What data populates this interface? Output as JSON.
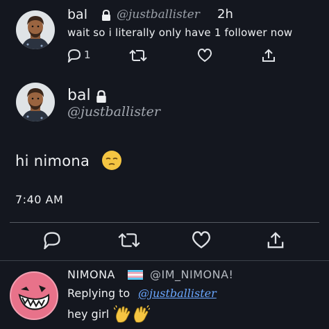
{
  "reply_tweet": {
    "name": "bal",
    "handle": "@justballister",
    "time": "2h",
    "text": "wait so i literally only have 1 follower now",
    "reply_count": "1",
    "actions": {
      "reply_icon": "reply-icon",
      "retweet_icon": "retweet-icon",
      "like_icon": "heart-icon",
      "share_icon": "share-icon"
    }
  },
  "main_tweet": {
    "name": "bal",
    "handle": "@justballister",
    "text": "hi nimona",
    "emoji": "relieved-face-emoji",
    "time": "7:40 AM"
  },
  "nimona_reply": {
    "name": "NIMONA",
    "handle": "@IM_NIMONA!",
    "replying_to_label": "Replying to",
    "replying_to_handle": "@justballister",
    "text": "hey girl",
    "emojis": [
      "waving-hands-emoji",
      "waving-hands-emoji"
    ]
  },
  "colors": {
    "background": "#14171f",
    "link": "#6aa7ff",
    "nimona_avatar": "#e8728a",
    "emoji_yellow": "#f5c542"
  }
}
